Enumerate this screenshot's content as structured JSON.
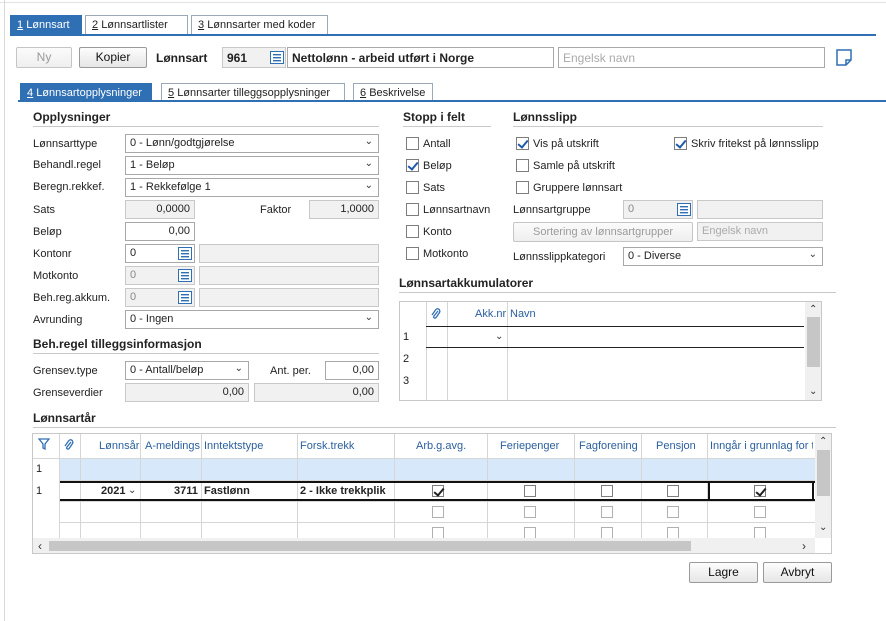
{
  "top_tabs": [
    {
      "num": "1",
      "label": "Lønnsart"
    },
    {
      "num": "2",
      "label": "Lønnsartlister"
    },
    {
      "num": "3",
      "label": "Lønnsarter med koder"
    }
  ],
  "toolbar": {
    "new_label": "Ny",
    "copy_label": "Kopier",
    "lonnsart_label": "Lønnsart",
    "lonnsart_code": "961",
    "lonnsart_name": "Nettolønn - arbeid utført i Norge",
    "english_name_placeholder": "Engelsk navn"
  },
  "sub_tabs": [
    {
      "num": "4",
      "label": "Lønnsartopplysninger"
    },
    {
      "num": "5",
      "label": "Lønnsarter tilleggsopplysninger"
    },
    {
      "num": "6",
      "label": "Beskrivelse"
    }
  ],
  "opplysninger": {
    "title": "Opplysninger",
    "lonnsarttype_label": "Lønnsarttype",
    "lonnsarttype_value": "0 - Lønn/godtgjørelse",
    "behandl_label": "Behandl.regel",
    "behandl_value": "1 - Beløp",
    "beregn_label": "Beregn.rekkef.",
    "beregn_value": "1 - Rekkefølge 1",
    "sats_label": "Sats",
    "sats_value": "0,0000",
    "faktor_label": "Faktor",
    "faktor_value": "1,0000",
    "belop_label": "Beløp",
    "belop_value": "0,00",
    "kontonr_label": "Kontonr",
    "kontonr_value": "0",
    "motkonto_label": "Motkonto",
    "motkonto_value": "0",
    "behregakkum_label": "Beh.reg.akkum.",
    "behregakkum_value": "0",
    "avrunding_label": "Avrunding",
    "avrunding_value": "0 - Ingen"
  },
  "tillegg": {
    "title": "Beh.regel tilleggsinformasjon",
    "grensev_label": "Grensev.type",
    "grensev_value": "0 - Antall/beløp",
    "antper_label": "Ant. per.",
    "antper_value": "0,00",
    "grenseverdier_label": "Grenseverdier",
    "grense1_value": "0,00",
    "grense2_value": "0,00"
  },
  "stopp": {
    "title": "Stopp i felt",
    "items": [
      {
        "label": "Antall",
        "checked": false
      },
      {
        "label": "Beløp",
        "checked": true
      },
      {
        "label": "Sats",
        "checked": false
      },
      {
        "label": "Lønnsartnavn",
        "checked": false
      },
      {
        "label": "Konto",
        "checked": false
      },
      {
        "label": "Motkonto",
        "checked": false
      }
    ]
  },
  "lonnsslipp": {
    "title": "Lønnsslipp",
    "vis_label": "Vis på utskrift",
    "samle_label": "Samle på utskrift",
    "gruppere_label": "Gruppere lønnsart",
    "fritekst_label": "Skriv fritekst på lønnsslipp",
    "gruppe_label": "Lønnsartgruppe",
    "gruppe_value": "0",
    "sortering_label": "Sortering av lønnsartgrupper",
    "engelsk_placeholder": "Engelsk navn",
    "kategori_label": "Lønnsslippkategori",
    "kategori_value": "0 - Diverse"
  },
  "akkumulatorer": {
    "title": "Lønnsartakkumulatorer",
    "col_akknr": "Akk.nr",
    "col_navn": "Navn",
    "rows": [
      "1",
      "2",
      "3"
    ]
  },
  "lonnsartar": {
    "title": "Lønnsartår",
    "headers": [
      "Lønnsår",
      "A-meldings",
      "Inntektstype",
      "Forsk.trekk",
      "Arb.g.avg.",
      "Feriepenger",
      "Fagforening",
      "Pensjon",
      "Inngår i grunnlag for t"
    ],
    "row_new_marker": "1",
    "row1": {
      "marker": "1",
      "year": "2021",
      "ameld": "3711",
      "inntektstype": "Fastlønn",
      "forsk": "2 - Ikke trekkplik"
    }
  },
  "footer": {
    "save_label": "Lagre",
    "cancel_label": "Avbryt"
  },
  "colors": {
    "accent": "#2f6fb3",
    "header_text": "#2a5f9e",
    "selected_row": "#d6e8fa"
  }
}
